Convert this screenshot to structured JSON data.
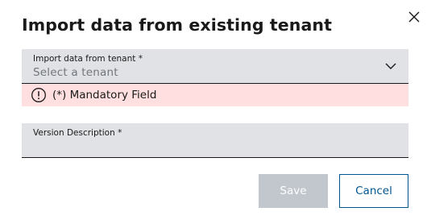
{
  "dialog": {
    "title": "Import data from existing tenant",
    "close_icon": "close-icon"
  },
  "tenant_select": {
    "label": "Import data from tenant *",
    "placeholder": "Select a tenant",
    "icon": "chevron-down-icon"
  },
  "error_banner": {
    "icon": "alert-circle-icon",
    "message": "(*) Mandatory Field",
    "background": "#ffdfdf"
  },
  "version_description": {
    "label": "Version Description *",
    "value": ""
  },
  "actions": {
    "save_label": "Save",
    "cancel_label": "Cancel",
    "save_disabled": true
  },
  "colors": {
    "field_bg": "#e0e2e5",
    "primary": "#005691",
    "disabled_bg": "#c1c7cc"
  }
}
